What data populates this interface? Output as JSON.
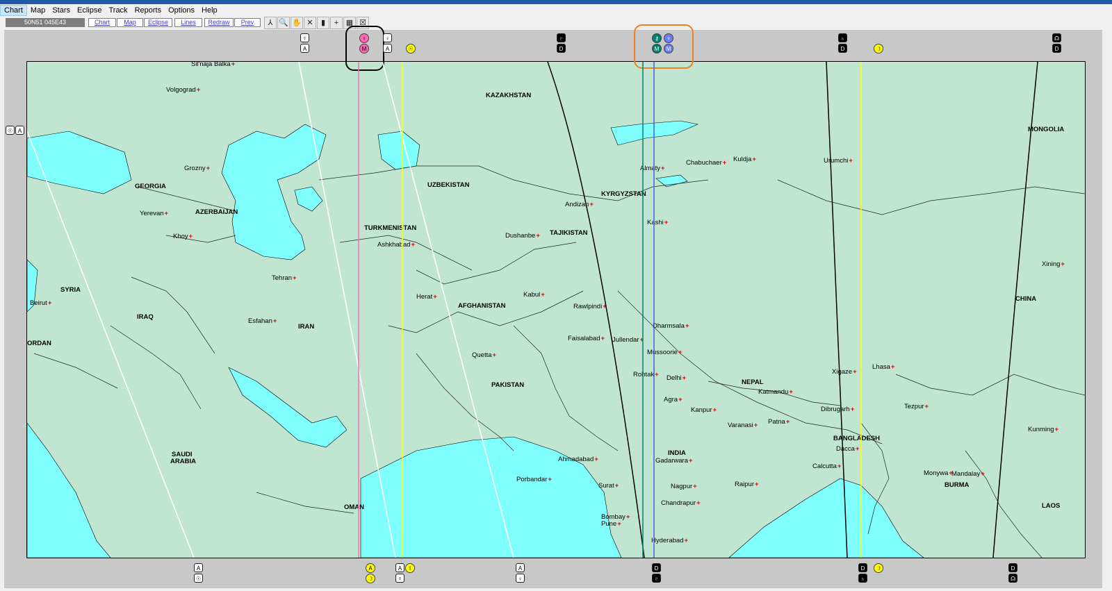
{
  "menubar": [
    "Chart",
    "Map",
    "Stars",
    "Eclipse",
    "Track",
    "Reports",
    "Options",
    "Help"
  ],
  "toolbar": {
    "coord": "50N51 045E43",
    "buttons": [
      "Chart",
      "Map",
      "Eclipse",
      "Lines",
      "Redraw",
      "Prev"
    ],
    "tools": [
      "pointer-tool-icon",
      "zoom-tool-icon",
      "hand-tool-icon",
      "cross-tool-icon",
      "bar-tool-icon",
      "plus-tool-icon",
      "grid-tool-icon",
      "close-tool-icon"
    ]
  },
  "map": {
    "countries": [
      {
        "t": "KAZAKHSTAN"
      },
      {
        "t": "UZBEKISTAN"
      },
      {
        "t": "TURKMENISTAN"
      },
      {
        "t": "KYRGYZSTAN"
      },
      {
        "t": "TAJIKISTAN"
      },
      {
        "t": "AFGHANISTAN"
      },
      {
        "t": "PAKISTAN"
      },
      {
        "t": "IRAN"
      },
      {
        "t": "IRAQ"
      },
      {
        "t": "SYRIA"
      },
      {
        "t": "GEORGIA"
      },
      {
        "t": "AZERBAIJAN"
      },
      {
        "t": "SAUDI"
      },
      {
        "t": "ARABIA"
      },
      {
        "t": "OMAN"
      },
      {
        "t": "INDIA"
      },
      {
        "t": "NEPAL"
      },
      {
        "t": "BANGLADESH"
      },
      {
        "t": "BURMA"
      },
      {
        "t": "CHINA"
      },
      {
        "t": "MONGOLIA"
      },
      {
        "t": "LAOS"
      },
      {
        "t": "ORDAN"
      }
    ],
    "cities": [
      {
        "t": "Sil'naja Balka"
      },
      {
        "t": "Volgograd"
      },
      {
        "t": "Grozny"
      },
      {
        "t": "Yerevan"
      },
      {
        "t": "Khoy"
      },
      {
        "t": "Tehran"
      },
      {
        "t": "Esfahan"
      },
      {
        "t": "Beirut"
      },
      {
        "t": "Ashkhabad"
      },
      {
        "t": "Herat"
      },
      {
        "t": "Kabul"
      },
      {
        "t": "Quetta"
      },
      {
        "t": "Dushanbe"
      },
      {
        "t": "Andizan"
      },
      {
        "t": "Almaty"
      },
      {
        "t": "Chabuchaer"
      },
      {
        "t": "Kuldja"
      },
      {
        "t": "Urumchi"
      },
      {
        "t": "Kashi"
      },
      {
        "t": "Rawlpindi"
      },
      {
        "t": "Faisalabad"
      },
      {
        "t": "Jullendar"
      },
      {
        "t": "Dharmsala"
      },
      {
        "t": "Mussoorie"
      },
      {
        "t": "Rohtak"
      },
      {
        "t": "Delhi"
      },
      {
        "t": "Agra"
      },
      {
        "t": "Kanpur"
      },
      {
        "t": "Katmandu"
      },
      {
        "t": "Varanasi"
      },
      {
        "t": "Patna"
      },
      {
        "t": "Lhasa"
      },
      {
        "t": "Xigaze"
      },
      {
        "t": "Dibrugarh"
      },
      {
        "t": "Tezpur"
      },
      {
        "t": "Dacca"
      },
      {
        "t": "Calcutta"
      },
      {
        "t": "Gadarwara"
      },
      {
        "t": "Ahmadabad"
      },
      {
        "t": "Porbandar"
      },
      {
        "t": "Surat"
      },
      {
        "t": "Bombay"
      },
      {
        "t": "Pune"
      },
      {
        "t": "Nagpur"
      },
      {
        "t": "Raipur"
      },
      {
        "t": "Chandrapur"
      },
      {
        "t": "Hyderabad"
      },
      {
        "t": "Monywa"
      },
      {
        "t": "Mandalay"
      },
      {
        "t": "Kunming"
      },
      {
        "t": "Xining"
      }
    ]
  },
  "lines": [
    {
      "name": "venus-mc-line",
      "color": "#ff69b4"
    },
    {
      "name": "sun-line",
      "color": "#ffff00"
    },
    {
      "name": "mercury-line",
      "color": "#ffffff"
    },
    {
      "name": "pluto-line",
      "color": "#000000"
    },
    {
      "name": "chiron-line",
      "color": "#00806e"
    },
    {
      "name": "neptune-line",
      "color": "#4a5fe0"
    },
    {
      "name": "moon-line",
      "color": "#ffff00"
    },
    {
      "name": "saturn-line",
      "color": "#000000"
    },
    {
      "name": "node-line",
      "color": "#000000"
    }
  ],
  "colors": {
    "land": "#c0e6d2",
    "water": "#80ffff",
    "frame": "#c8c8c8",
    "circle_black": "#000000",
    "circle_orange": "#f08020"
  }
}
